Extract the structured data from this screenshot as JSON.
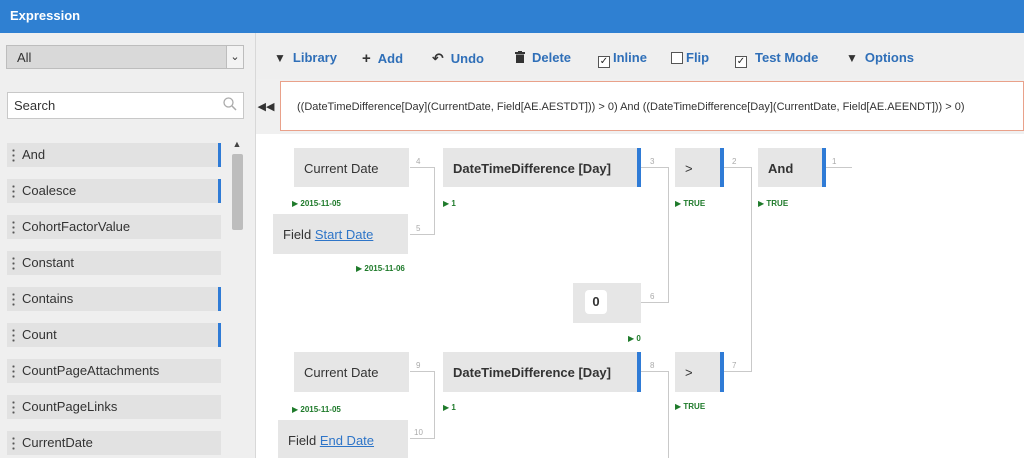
{
  "window": {
    "title": "Expression"
  },
  "sidebar": {
    "category": "All",
    "search_placeholder": "Search",
    "items": [
      {
        "label": "And",
        "bar": true
      },
      {
        "label": "Coalesce",
        "bar": true
      },
      {
        "label": "CohortFactorValue",
        "bar": false
      },
      {
        "label": "Constant",
        "bar": false
      },
      {
        "label": "Contains",
        "bar": true
      },
      {
        "label": "Count",
        "bar": true
      },
      {
        "label": "CountPageAttachments",
        "bar": false
      },
      {
        "label": "CountPageLinks",
        "bar": false
      },
      {
        "label": "CurrentDate",
        "bar": false
      }
    ]
  },
  "toolbar": {
    "library": "Library",
    "add": "Add",
    "undo": "Undo",
    "delete": "Delete",
    "inline": "Inline",
    "inline_checked": true,
    "flip": "Flip",
    "flip_checked": false,
    "test_mode": "Test Mode",
    "test_mode_checked": true,
    "options": "Options"
  },
  "expression": "((DateTimeDifference[Day](CurrentDate, Field[AE.AESTDT])) > 0) And ((DateTimeDifference[Day](CurrentDate, Field[AE.AEENDT])) > 0)",
  "graph": {
    "cd1": "Current Date",
    "dtd1": "DateTimeDifference [Day]",
    "gt1": ">",
    "and": "And",
    "field1_prefix": "Field",
    "field1_link": "Start Date",
    "zero": "0",
    "cd2": "Current Date",
    "dtd2": "DateTimeDifference [Day]",
    "gt2": ">",
    "field2_prefix": "Field",
    "field2_link": "End Date",
    "pins": {
      "p4": "4",
      "p3": "3",
      "p2": "2",
      "p1": "1",
      "p5": "5",
      "p6": "6",
      "p9": "9",
      "p8": "8",
      "p7": "7",
      "p10": "10"
    },
    "results": {
      "cd1": "2015-11-05",
      "dtd1": "1",
      "gt1": "TRUE",
      "and": "TRUE",
      "field1": "2015-11-06",
      "zero": "0",
      "cd2": "2015-11-05",
      "dtd2": "1",
      "gt2": "TRUE"
    }
  }
}
